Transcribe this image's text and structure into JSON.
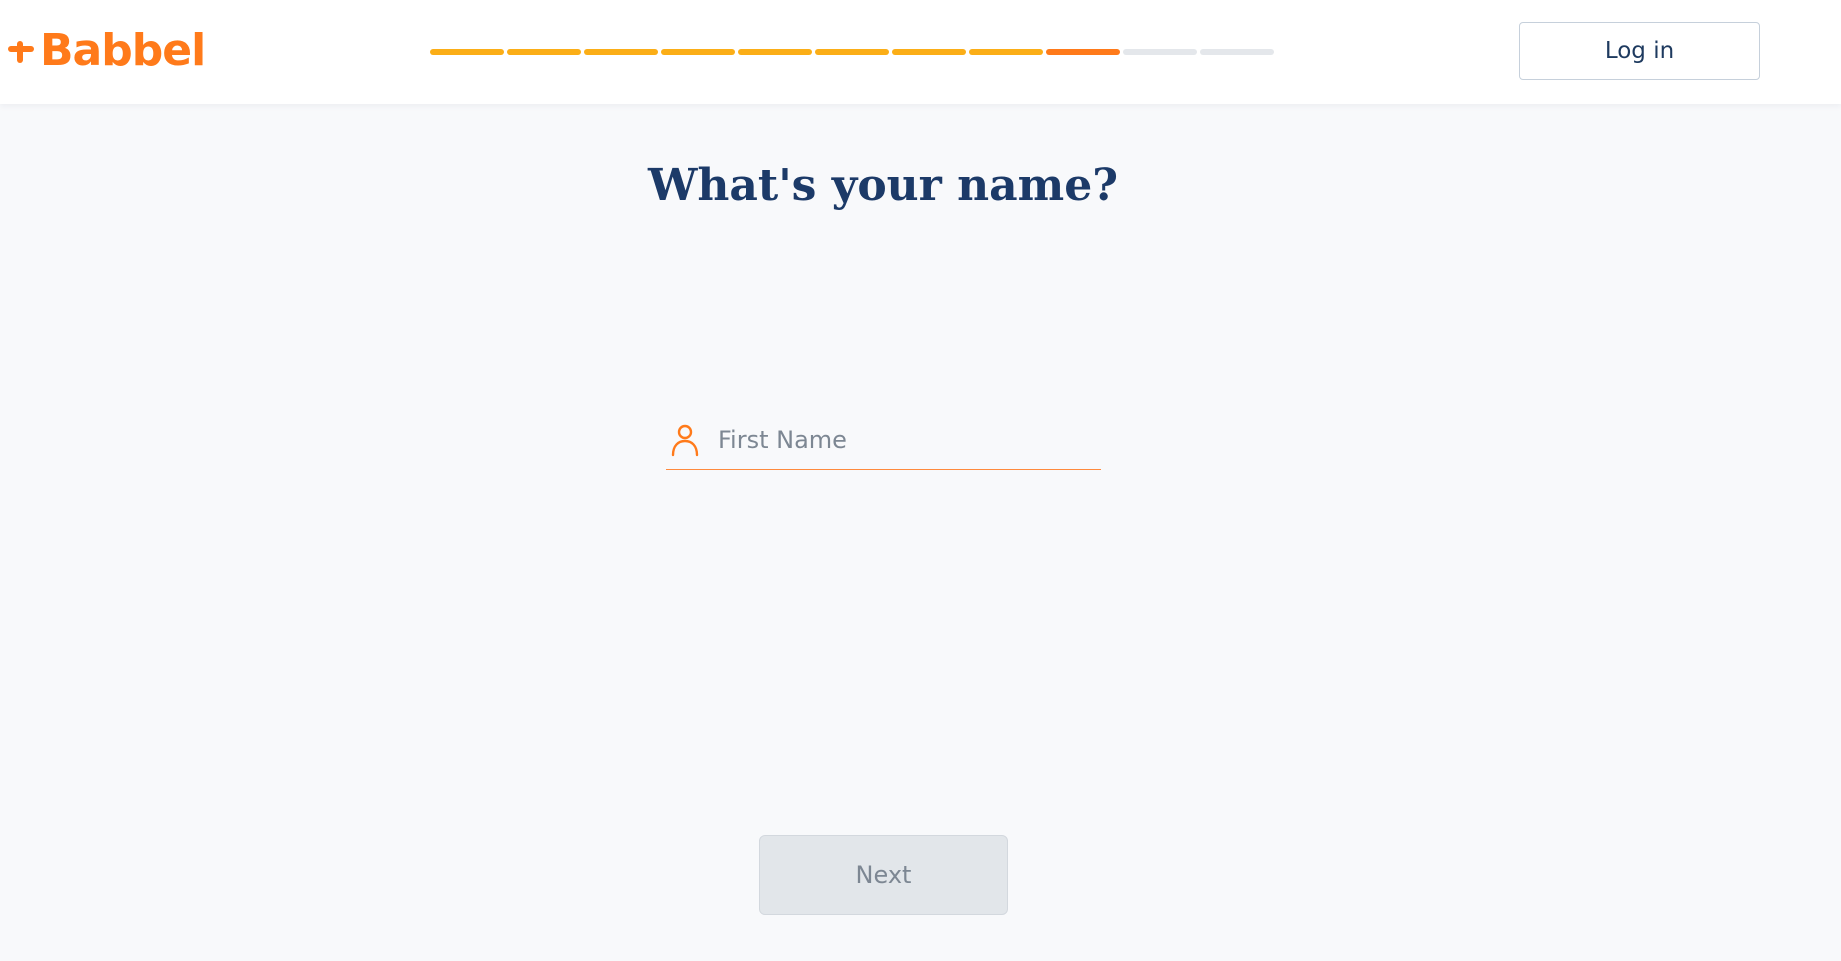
{
  "brand": {
    "name": "Babbel",
    "color": "#ff7a1a"
  },
  "progress": {
    "total_steps": 11,
    "completed_steps": 9,
    "current_step": 9,
    "completed_color": "#fbae17",
    "current_color": "#ff7a1a",
    "remaining_color": "#e4e7eb"
  },
  "header": {
    "login_label": "Log in"
  },
  "main": {
    "title": "What's your name?",
    "first_name": {
      "placeholder": "First Name",
      "value": "",
      "icon": "person-icon",
      "accent": "#ff8a3d"
    },
    "next_label": "Next"
  }
}
